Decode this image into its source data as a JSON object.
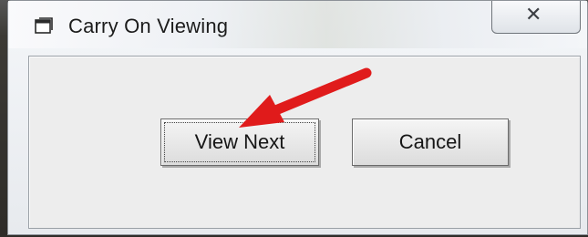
{
  "window": {
    "title": "Carry On Viewing",
    "close_symbol": "✕",
    "title_icon": "window-dialog-icon",
    "close_icon": "close-icon"
  },
  "buttons": {
    "view_next": "View Next",
    "cancel": "Cancel"
  },
  "annotation": {
    "arrow_color": "#e01b1b",
    "points_to": "view-next-button"
  },
  "colors": {
    "window_bg": "#e9ecf0",
    "client_bg": "#ededed",
    "button_border": "#6b6b6b"
  }
}
